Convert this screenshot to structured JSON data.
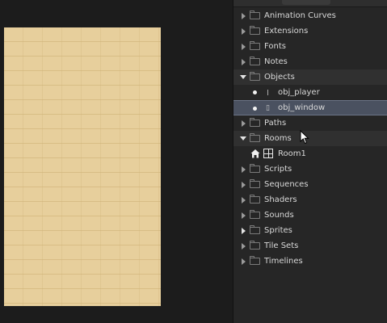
{
  "asset_browser": {
    "folders_top": [
      {
        "label": "Animation Curves"
      },
      {
        "label": "Extensions"
      },
      {
        "label": "Fonts"
      },
      {
        "label": "Notes"
      }
    ],
    "objects": {
      "label": "Objects",
      "children": [
        {
          "label": "obj_player"
        },
        {
          "label": "obj_window"
        }
      ]
    },
    "paths": {
      "label": "Paths"
    },
    "rooms": {
      "label": "Rooms",
      "children": [
        {
          "label": "Room1"
        }
      ]
    },
    "folders_bottom": [
      {
        "label": "Scripts"
      },
      {
        "label": "Sequences"
      },
      {
        "label": "Shaders"
      },
      {
        "label": "Sounds"
      },
      {
        "label": "Sprites"
      },
      {
        "label": "Tile Sets"
      },
      {
        "label": "Timelines"
      }
    ]
  },
  "colors": {
    "selection": "#4a5160",
    "room_sprite": "#e7cf9c",
    "panel": "#262626"
  }
}
